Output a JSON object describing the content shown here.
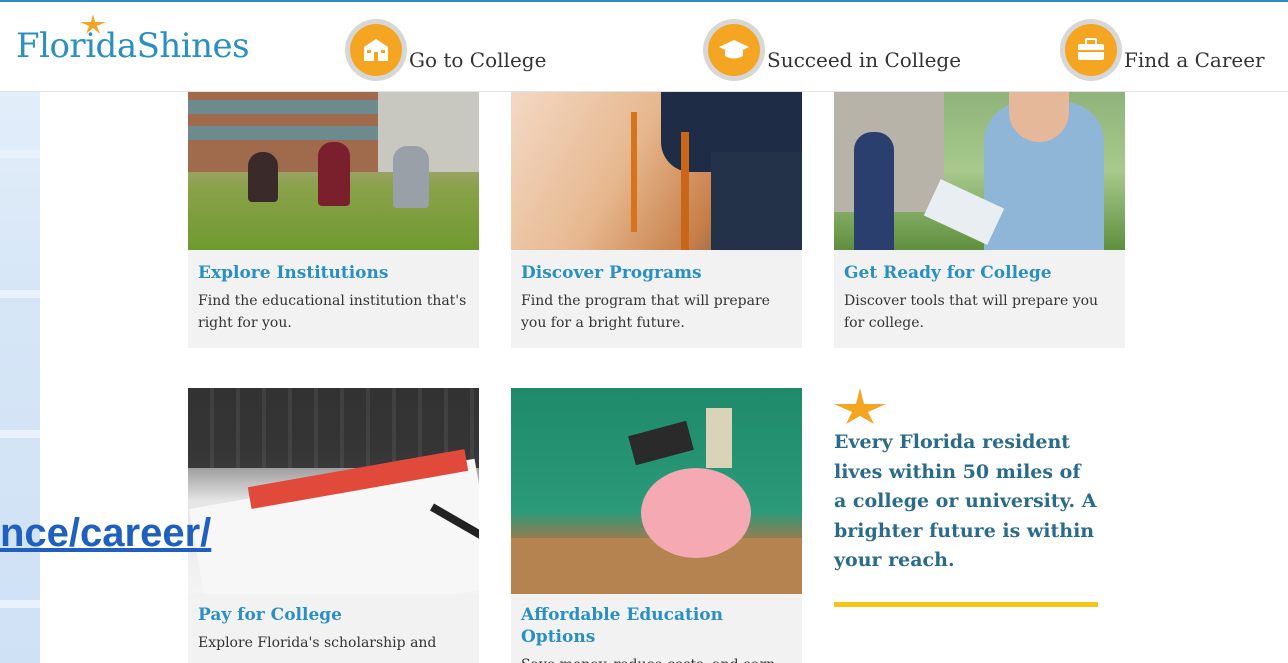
{
  "header": {
    "logo_text": "FloridaShines",
    "nav": [
      {
        "label": "Go to College",
        "icon": "school-building-icon"
      },
      {
        "label": "Succeed in College",
        "icon": "graduation-cap-icon"
      },
      {
        "label": "Find a Career",
        "icon": "briefcase-icon"
      }
    ]
  },
  "cards": [
    {
      "title": "Explore Institutions",
      "desc": "Find the educational institution that's right for you.",
      "image": "students-on-lawn-photo"
    },
    {
      "title": "Discover Programs",
      "desc": "Find the program that will prepare you for a bright future.",
      "image": "graduation-cap-tassel-photo"
    },
    {
      "title": "Get Ready for College",
      "desc": "Discover tools that will prepare you for college.",
      "image": "student-with-paper-photo"
    },
    {
      "title": "Pay for College",
      "desc": "Explore Florida's scholarship and",
      "image": "scholarship-application-photo"
    },
    {
      "title": "Affordable Education Options",
      "desc": "Save money, reduce costs, and earn",
      "image": "piggy-bank-photo"
    }
  ],
  "promo": {
    "text": "Every Florida resident lives within 50 miles of a college or university. A brighter future is within your reach."
  },
  "overlay_link": {
    "text": "nce/career/"
  },
  "colors": {
    "brand_blue": "#2a8fc1",
    "accent_orange": "#f4a623",
    "accent_yellow": "#f5c518",
    "link_blue": "#1f5fbf"
  }
}
